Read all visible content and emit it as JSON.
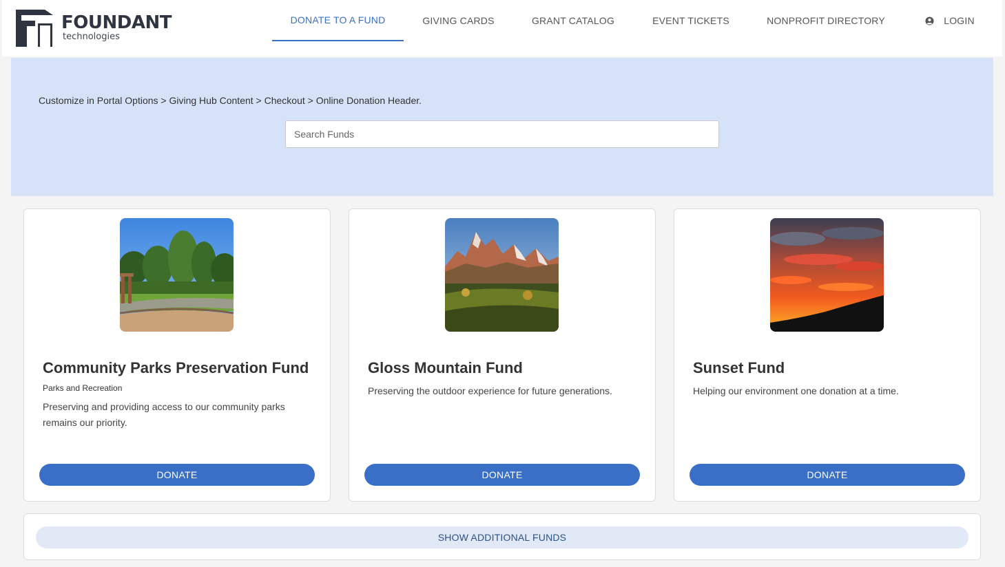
{
  "brand": {
    "name": "FOUNDANT",
    "tagline": "technologies"
  },
  "nav": {
    "items": [
      {
        "label": "DONATE TO A FUND",
        "active": true
      },
      {
        "label": "GIVING CARDS",
        "active": false
      },
      {
        "label": "GRANT CATALOG",
        "active": false
      },
      {
        "label": "EVENT TICKETS",
        "active": false
      },
      {
        "label": "NONPROFIT DIRECTORY",
        "active": false
      }
    ],
    "login": {
      "label": "LOGIN",
      "icon": "user-circle-icon"
    }
  },
  "banner": {
    "text": "Customize in Portal Options > Giving Hub Content > Checkout > Online Donation Header.",
    "search_placeholder": "Search Funds"
  },
  "funds": [
    {
      "title": "Community Parks Preservation Fund",
      "category": "Parks and Recreation",
      "description": "Preserving and providing access to our community parks remains our priority.",
      "button": "DONATE",
      "image": "park-photo"
    },
    {
      "title": "Gloss Mountain Fund",
      "category": "",
      "description": "Preserving the outdoor experience for future generations.",
      "button": "DONATE",
      "image": "mountain-photo"
    },
    {
      "title": "Sunset Fund",
      "category": "",
      "description": "Helping our environment one donation at a time.",
      "button": "DONATE",
      "image": "sunset-photo"
    }
  ],
  "more_button": "SHOW ADDITIONAL FUNDS",
  "colors": {
    "accent": "#3a6fc8",
    "banner": "#d6e2f8",
    "more_button_bg": "#e2e9f6"
  }
}
